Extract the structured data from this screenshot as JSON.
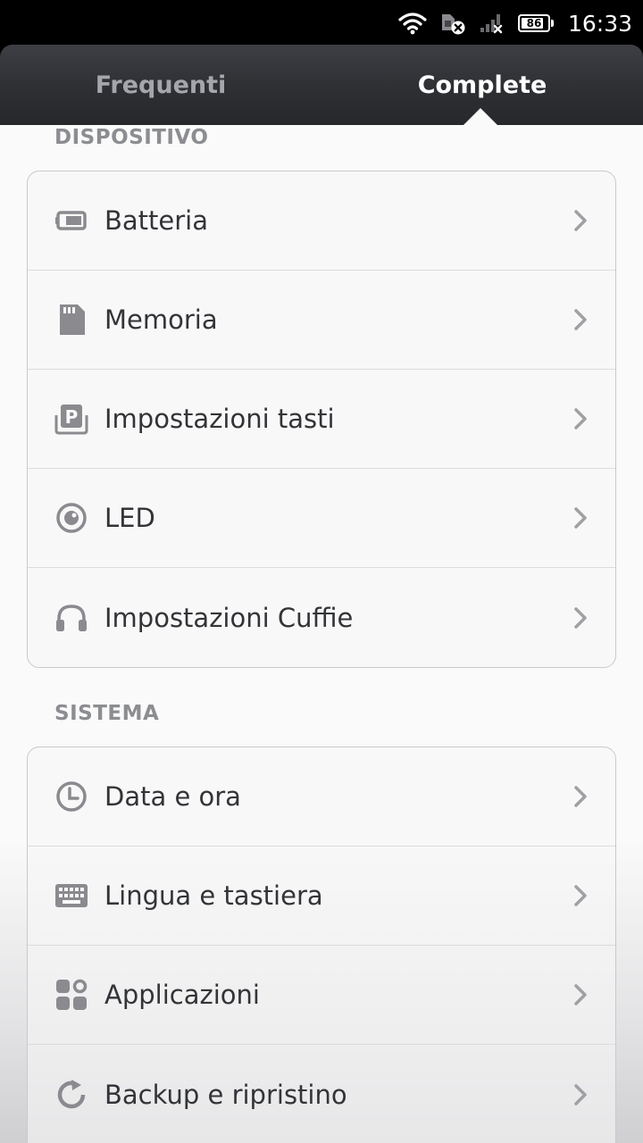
{
  "status_bar": {
    "battery_level": "86",
    "battery_fraction": 0.86,
    "time": "16:33"
  },
  "tabs": [
    {
      "label": "Frequenti",
      "selected": false
    },
    {
      "label": "Complete",
      "selected": true
    }
  ],
  "sections": [
    {
      "title": "DISPOSITIVO",
      "items": [
        {
          "label": "Batteria",
          "icon": "battery-icon"
        },
        {
          "label": "Memoria",
          "icon": "sd-card-icon"
        },
        {
          "label": "Impostazioni tasti",
          "icon": "button-settings-icon"
        },
        {
          "label": "LED",
          "icon": "led-icon"
        },
        {
          "label": "Impostazioni Cuffie",
          "icon": "headphones-icon"
        }
      ]
    },
    {
      "title": "SISTEMA",
      "items": [
        {
          "label": "Data e ora",
          "icon": "clock-icon"
        },
        {
          "label": "Lingua e tastiera",
          "icon": "keyboard-icon"
        },
        {
          "label": "Applicazioni",
          "icon": "apps-icon"
        },
        {
          "label": "Backup e ripristino",
          "icon": "backup-icon"
        }
      ]
    }
  ],
  "colors": {
    "icon": "#8a8a8f",
    "label": "#333438",
    "section_title": "#8c8d91",
    "tab_active": "#ffffff",
    "tab_inactive": "#a4a6ab"
  }
}
